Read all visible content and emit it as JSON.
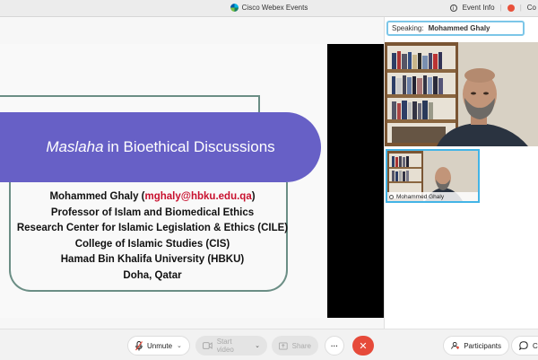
{
  "titlebar": {
    "app_title": "Cisco Webex Events",
    "event_info": "Event Info",
    "cut_label": "Co"
  },
  "slide": {
    "title_italic": "Maslaha",
    "title_rest": "in Bioethical Discussions",
    "name_prefix": "Mohammed Ghaly (",
    "email": "mghaly@hbku.edu.qa",
    "name_suffix": ")",
    "lines": [
      "Professor of Islam and Biomedical Ethics",
      "Research Center for Islamic Legislation & Ethics (CILE)",
      "College of Islamic Studies (CIS)",
      "Hamad Bin Khalifa University (HBKU)",
      "Doha, Qatar"
    ],
    "banner_color": "#6760c6",
    "email_color": "#c8102e"
  },
  "panel": {
    "speaking_label": "Speaking:",
    "speaker_name": "Mohammed Ghaly",
    "thumb_name": "Mohammed Ghaly"
  },
  "controls": {
    "unmute": "Unmute",
    "start_video": "Start video",
    "share": "Share",
    "more": "···",
    "end": "✕",
    "participants": "Participants",
    "chat": "Ch"
  }
}
